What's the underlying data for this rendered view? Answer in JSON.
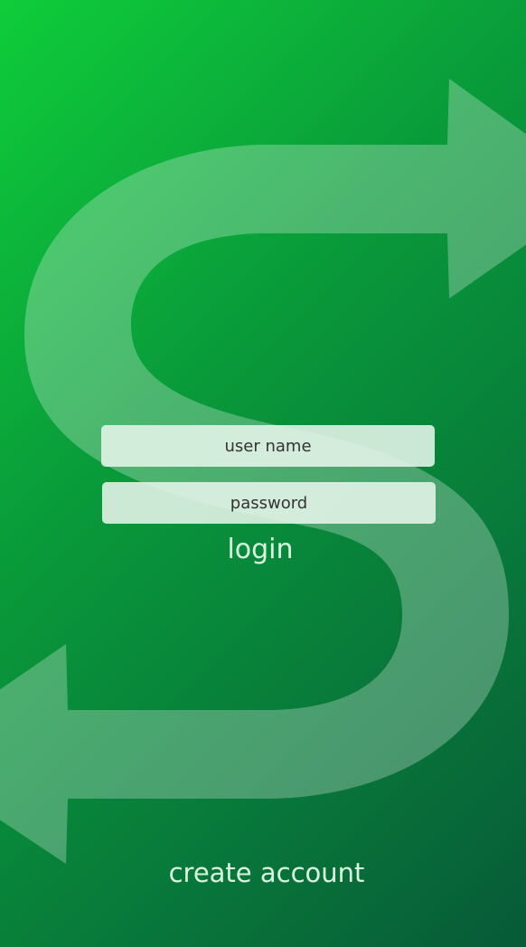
{
  "login_form": {
    "username_placeholder": "user name",
    "password_placeholder": "password",
    "login_label": "login"
  },
  "create_account_label": "create account",
  "colors": {
    "bg_start": "#0fcd3a",
    "bg_end": "#075a38",
    "text_light": "#d8f5df"
  }
}
